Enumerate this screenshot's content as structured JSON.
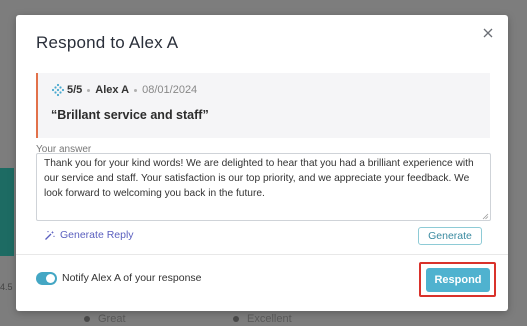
{
  "background": {
    "left_number": "4.5",
    "legend": [
      {
        "label": "Great"
      },
      {
        "label": "Excellent"
      }
    ]
  },
  "modal": {
    "title": "Respond to Alex A",
    "review": {
      "rating": "5/5",
      "author": "Alex A",
      "date": "08/01/2024",
      "text": "“Brillant service and staff”"
    },
    "answer": {
      "label": "Your answer",
      "value": "Thank you for your kind words! We are delighted to hear that you had a brilliant experience with our service and staff. Your satisfaction is our top priority, and we appreciate your feedback. We look forward to welcoming you back in the future."
    },
    "generate_reply_label": "Generate Reply",
    "generate_button_label": "Generate",
    "notify": {
      "label": "Notify Alex A of your response",
      "checked": true
    },
    "respond_button_label": "Respond"
  },
  "colors": {
    "accent": "#4fb2cf",
    "review_border": "#e2714a",
    "highlight": "#d9322b",
    "generate_link": "#5a5fbf"
  }
}
